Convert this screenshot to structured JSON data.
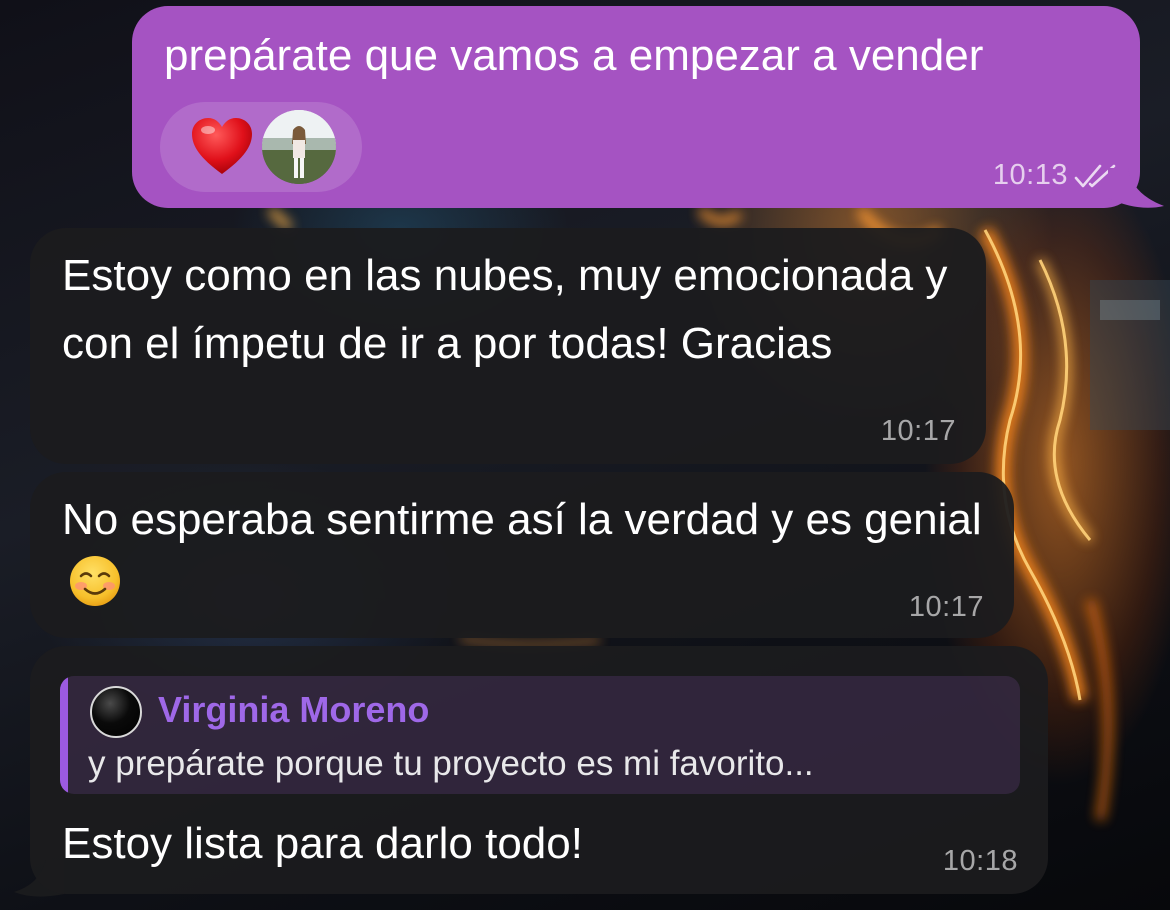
{
  "messages": [
    {
      "direction": "outgoing",
      "text": "prepárate que vamos a empezar a vender",
      "time": "10:13",
      "status": "read-double-check-icon",
      "reaction": {
        "emoji": "heart-icon",
        "by": "reactor-avatar"
      }
    },
    {
      "direction": "incoming",
      "text": "Estoy como en las nubes, muy emocionada y con el ímpetu de ir a por todas! Gracias",
      "time": "10:17"
    },
    {
      "direction": "incoming",
      "text": "No esperaba sentirme así la verdad y es genial",
      "emoji": "smiling-face-icon",
      "time": "10:17"
    },
    {
      "direction": "incoming",
      "reply_to": {
        "author": "Virginia Moreno",
        "text": "y prepárate porque tu proyecto es mi favorito..."
      },
      "text": "Estoy lista para darlo todo!",
      "time": "10:18"
    }
  ],
  "colors": {
    "outgoing_bubble": "#a553c2",
    "incoming_bubble": "#1c1c1e",
    "reply_accent": "#9b5ae0",
    "reply_name": "#9f68e8"
  }
}
